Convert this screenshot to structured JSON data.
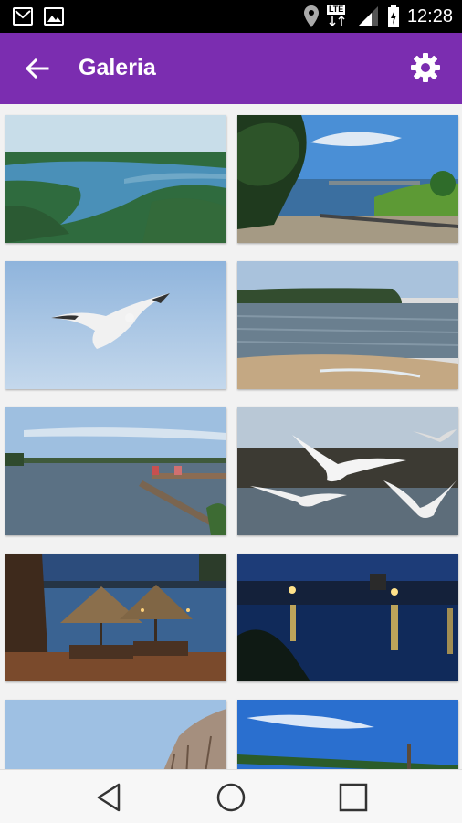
{
  "status_bar": {
    "time": "12:28",
    "network": "LTE",
    "icons": [
      "gmail-icon",
      "gallery-icon",
      "location-icon",
      "lte-icon",
      "signal-icon",
      "battery-icon"
    ]
  },
  "toolbar": {
    "title": "Galeria",
    "back_icon": "arrow-back-icon",
    "settings_icon": "gear-icon",
    "color": "#7b2db0"
  },
  "gallery": {
    "photos": [
      {
        "subject": "aerial-forest-lake"
      },
      {
        "subject": "lake-shore-pier-tree"
      },
      {
        "subject": "seagull-flying"
      },
      {
        "subject": "lake-beach-shore"
      },
      {
        "subject": "lake-pier"
      },
      {
        "subject": "seagulls-over-lake"
      },
      {
        "subject": "evening-terrace-umbrellas"
      },
      {
        "subject": "night-lake-lights"
      },
      {
        "subject": "sky-with-tree"
      },
      {
        "subject": "lake-blue-sky"
      }
    ]
  },
  "nav_bar": {
    "icons": [
      "back-triangle-icon",
      "home-circle-icon",
      "recents-square-icon"
    ]
  }
}
